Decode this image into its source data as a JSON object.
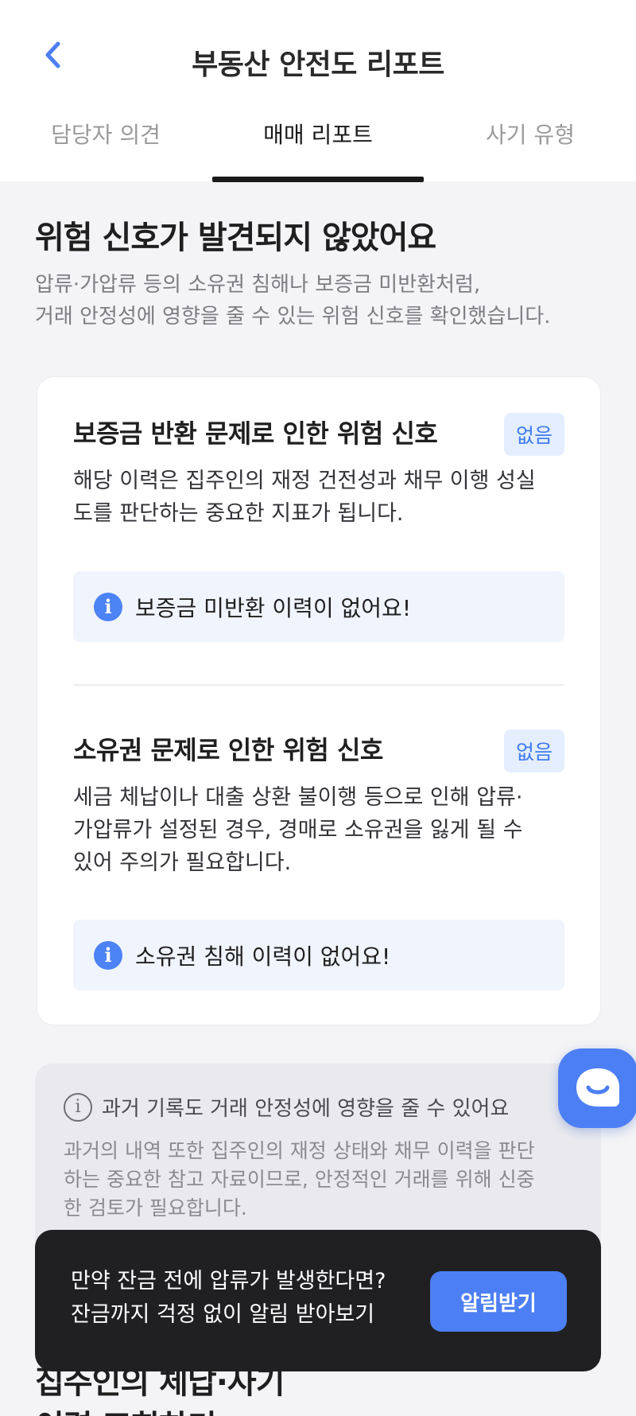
{
  "header": {
    "title": "부동산 안전도 리포트"
  },
  "tabs": [
    {
      "label": "담당자 의견"
    },
    {
      "label": "매매 리포트"
    },
    {
      "label": "사기 유형"
    }
  ],
  "summary": {
    "heading": "위험 신호가 발견되지 않았어요",
    "description_line1": "압류·가압류 등의 소유권 침해나 보증금 미반환처럼,",
    "description_line2": "거래 안정성에 영향을 줄 수 있는 위험 신호를 확인했습니다."
  },
  "risk_items": [
    {
      "title": "보증금 반환 문제로 인한 위험 신호",
      "badge": "없음",
      "desc_line1": "해당 이력은 집주인의 재정 건전성과 채무 이행 성실",
      "desc_line2": "도를 판단하는 중요한 지표가 됩니다.",
      "desc_line3": "",
      "info": "보증금 미반환 이력이 없어요!"
    },
    {
      "title": "소유권 문제로 인한 위험 신호",
      "badge": "없음",
      "desc_line1": "세금 체납이나 대출 상환 불이행 등으로 인해 압류·",
      "desc_line2": "가압류가 설정된 경우, 경매로 소유권을 잃게 될 수",
      "desc_line3": "있어 주의가 필요합니다.",
      "info": "소유권 침해 이력이 없어요!"
    }
  ],
  "history": {
    "title": "과거 기록도 거래 안정성에 영향을 줄 수 있어요",
    "desc_line1": "과거의 내역 또한 집주인의 재정 상태와 채무 이력을 판단",
    "desc_line2": "하는 중요한 참고 자료이므로, 안정적인 거래를 위해 신중",
    "desc_line3": "한 검토가 필요합니다."
  },
  "next_section": {
    "line1": "집주인의 체납·사기",
    "line2": "이력 조회하기"
  },
  "banner": {
    "line1": "만약 잔금 전에 압류가 발생한다면?",
    "line2": "잔금까지 걱정 없이 알림 받아보기",
    "button": "알림받기"
  },
  "icons": {
    "back": "chevron-left-icon",
    "info": "info-icon",
    "chat": "chat-bubble-icon"
  },
  "colors": {
    "accent": "#4d7ff4",
    "badge_bg": "#e4eeff",
    "banner_bg": "#202022"
  }
}
